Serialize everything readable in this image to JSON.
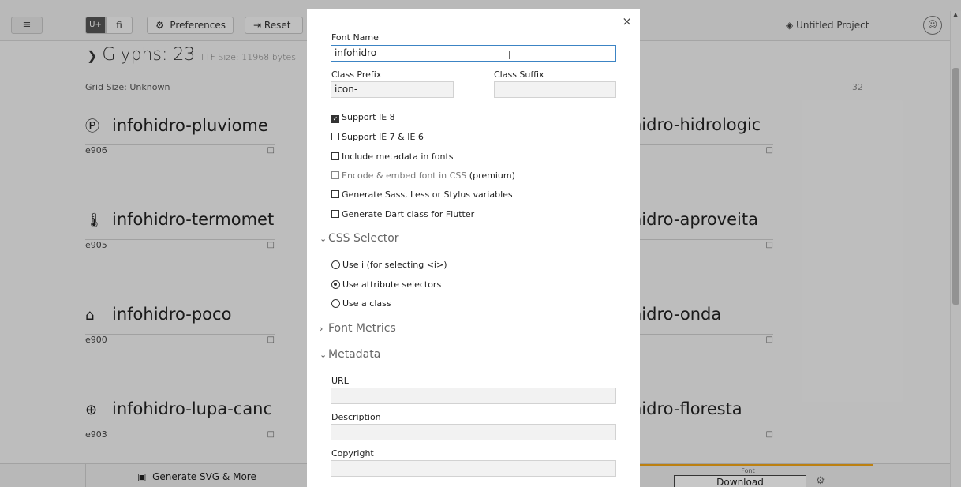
{
  "toolbar": {
    "menu_icon": "≡",
    "unicode_label": "U+",
    "ligature_label": "fi",
    "preferences_label": "Preferences",
    "reset_label": "Reset",
    "project_name": "Untitled Project"
  },
  "glyphs_header": {
    "title": "Glyphs: 23",
    "ttf_size": "TTF Size: 11968 bytes",
    "grid_size": "Grid Size: Unknown",
    "grid_value": "32"
  },
  "glyphs": {
    "left": [
      {
        "icon": "P",
        "name": "infohidro-pluviome",
        "code": "e906"
      },
      {
        "icon": "🌡",
        "name": "infohidro-termomet",
        "code": "e905"
      },
      {
        "icon": "⌂",
        "name": "infohidro-poco",
        "code": "e900"
      },
      {
        "icon": "⊕",
        "name": "infohidro-lupa-canc",
        "code": "e903"
      }
    ],
    "right": [
      {
        "name": "hidro-hidrologic"
      },
      {
        "name": "hidro-aproveita"
      },
      {
        "name": "hidro-onda"
      },
      {
        "name": "hidro-floresta"
      }
    ]
  },
  "bottom": {
    "generate_label": "Generate SVG & More",
    "font_tab_label": "Font",
    "download_label": "Download"
  },
  "modal": {
    "close_icon": "×",
    "font_name_label": "Font Name",
    "font_name_value": "infohidro",
    "class_prefix_label": "Class Prefix",
    "class_prefix_value": "icon-",
    "class_suffix_label": "Class Suffix",
    "class_suffix_value": "",
    "options": [
      {
        "label": "Support IE 8",
        "checked": true
      },
      {
        "label": "Support IE 7 & IE 6",
        "checked": false
      },
      {
        "label": "Include metadata in fonts",
        "checked": false
      },
      {
        "label": "Encode & embed font in CSS",
        "premium": "(premium)",
        "checked": false
      },
      {
        "label": "Generate Sass, Less or Stylus variables",
        "checked": false
      },
      {
        "label": "Generate Dart class for Flutter",
        "checked": false
      }
    ],
    "css_selector_title": "CSS Selector",
    "selector_options": [
      {
        "label": "Use i (for selecting <i>)",
        "selected": false
      },
      {
        "label": "Use attribute selectors",
        "selected": true
      },
      {
        "label": "Use a class",
        "selected": false
      }
    ],
    "font_metrics_title": "Font Metrics",
    "metadata_title": "Metadata",
    "url_label": "URL",
    "description_label": "Description",
    "copyright_label": "Copyright"
  }
}
